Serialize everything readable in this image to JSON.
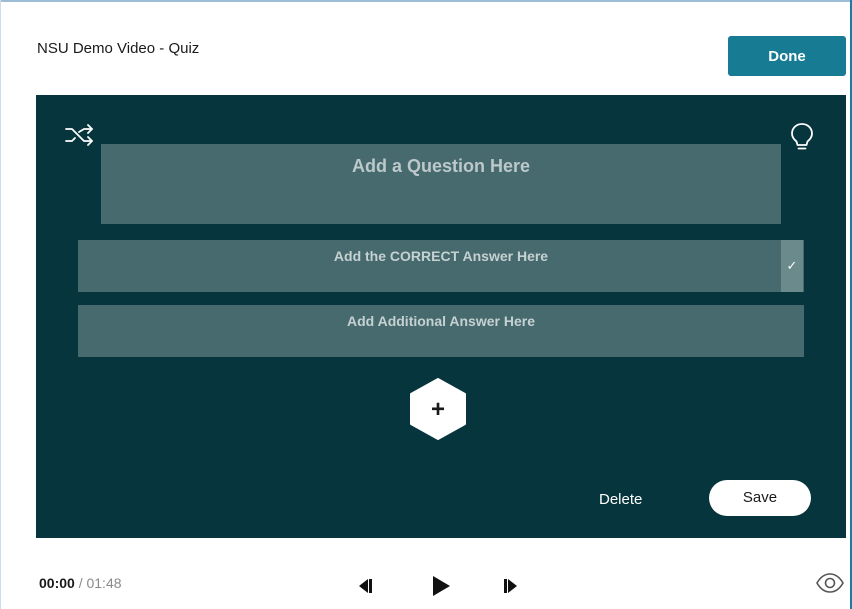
{
  "header": {
    "title": "NSU Demo Video - Quiz",
    "done_label": "Done"
  },
  "quiz": {
    "question_placeholder": "Add a Question Here",
    "answers": [
      {
        "placeholder": "Add the CORRECT Answer Here",
        "correct": true,
        "mark": "✓"
      },
      {
        "placeholder": "Add Additional Answer Here",
        "correct": false
      }
    ],
    "add_label": "+",
    "delete_label": "Delete",
    "save_label": "Save"
  },
  "player": {
    "current_time": "00:00",
    "separator": " / ",
    "total_time": "01:48"
  },
  "icons": {
    "shuffle": "shuffle-icon",
    "hint": "lightbulb-icon",
    "add": "add-hexagon-icon",
    "prev": "step-back-icon",
    "play": "play-icon",
    "next": "step-forward-icon",
    "preview": "eye-icon"
  },
  "colors": {
    "panel_bg": "#06353e",
    "field_bg": "#466a6d",
    "accent": "#167b93"
  }
}
